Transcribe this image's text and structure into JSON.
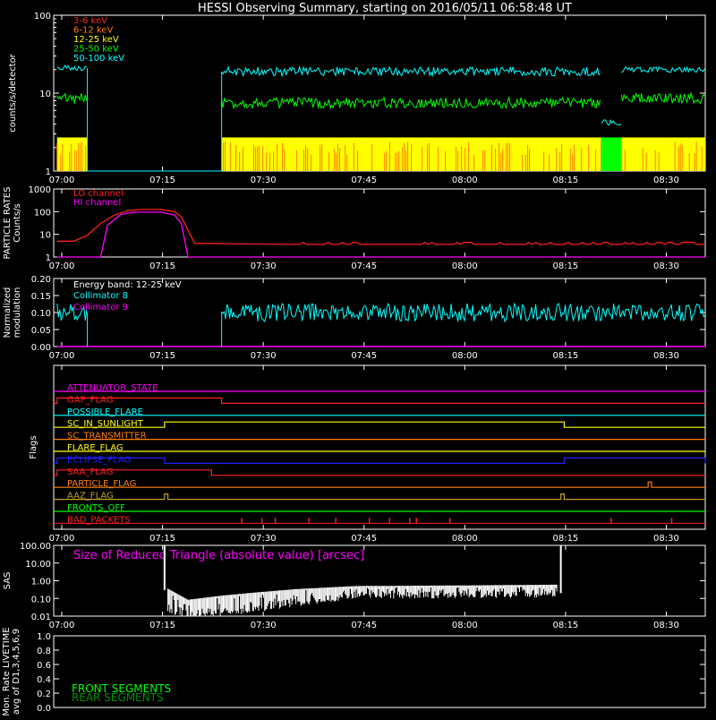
{
  "title": "HESSI Observing Summary, starting on 2016/05/11 06:58:48 UT",
  "time_ticks": [
    "07:00",
    "07:15",
    "07:30",
    "07:45",
    "08:00",
    "08:15",
    "08:30"
  ],
  "colors": {
    "bg": "#000000",
    "fg": "#ffffff",
    "red": "#ff2020",
    "orange": "#ff8000",
    "yellow": "#ffff00",
    "green": "#00ff00",
    "cyan": "#00ffff",
    "magenta": "#ff00ff",
    "blue": "#2020ff",
    "olive": "#c0a020",
    "purple": "#c030c0"
  },
  "chart_data": [
    {
      "type": "line",
      "id": "counts",
      "ylabel": "counts/s/detector",
      "yscale": "log",
      "ylim": [
        1,
        100
      ],
      "yticks": [
        "1",
        "10",
        "100"
      ],
      "x_range_min": [
        0,
        97
      ],
      "series": [
        {
          "name": "3-6 keV",
          "color": "#ff2020"
        },
        {
          "name": "6-12 keV",
          "color": "#ff8000"
        },
        {
          "name": "12-25 keV",
          "color": "#ffff00",
          "segments": [
            {
              "x": [
                0.5,
                5
              ],
              "y": 1.5
            },
            {
              "x": [
                25,
                81.5
              ],
              "y": 1.5
            },
            {
              "x": [
                84.5,
                97
              ],
              "y": 1.5
            }
          ]
        },
        {
          "name": "25-50 keV",
          "color": "#00ff00",
          "segments": [
            {
              "x": [
                0.5,
                5
              ],
              "y": 8.5
            },
            {
              "x": [
                25,
                81.5
              ],
              "y": 7.5
            },
            {
              "x": [
                84.5,
                97
              ],
              "y": 8.5
            },
            {
              "x": [
                81.5,
                84.5
              ],
              "y": 1.3
            }
          ]
        },
        {
          "name": "50-100 keV",
          "color": "#00ffff",
          "segments": [
            {
              "x": [
                0.5,
                5
              ],
              "y": 21
            },
            {
              "x": [
                25,
                81.5
              ],
              "y": 19
            },
            {
              "x": [
                81.5,
                84.5
              ],
              "y": 4.2
            },
            {
              "x": [
                84.5,
                97
              ],
              "y": 20
            }
          ]
        }
      ]
    },
    {
      "type": "line",
      "id": "particle",
      "ylabel": "PARTICLE RATES",
      "ylabel2": "Counts/s",
      "yscale": "log",
      "ylim": [
        1,
        1000
      ],
      "yticks": [
        "1",
        "10",
        "100",
        "1000"
      ],
      "series": [
        {
          "name": "LO channel",
          "color": "#ff2020",
          "points": [
            [
              0.5,
              5
            ],
            [
              3,
              5
            ],
            [
              5,
              9
            ],
            [
              7,
              30
            ],
            [
              9,
              70
            ],
            [
              11,
              110
            ],
            [
              13,
              125
            ],
            [
              16,
              125
            ],
            [
              18,
              100
            ],
            [
              19,
              60
            ],
            [
              20,
              15
            ],
            [
              21,
              4
            ],
            [
              24,
              3.2
            ],
            [
              30,
              3.4
            ],
            [
              35,
              4.2
            ],
            [
              97,
              4
            ]
          ]
        },
        {
          "name": "HI channel",
          "color": "#ff00ff",
          "points": [
            [
              0.5,
              1
            ],
            [
              7,
              1
            ],
            [
              8,
              25
            ],
            [
              10,
              75
            ],
            [
              12,
              95
            ],
            [
              16,
              95
            ],
            [
              18,
              70
            ],
            [
              19,
              30
            ],
            [
              20,
              1
            ],
            [
              97,
              1
            ]
          ]
        }
      ]
    },
    {
      "type": "line",
      "id": "modulation",
      "ylabel": "Normalized",
      "ylabel2": "modulation",
      "ylim": [
        0,
        0.2
      ],
      "yticks": [
        "0.00",
        "0.05",
        "0.10",
        "0.15",
        "0.20"
      ],
      "annotation": "Energy band: 12-25 keV",
      "series": [
        {
          "name": "Collimator 8",
          "color": "#00ffff",
          "segments": [
            {
              "x": [
                0.5,
                5
              ],
              "y": 0.1
            },
            {
              "x": [
                25,
                97
              ],
              "y": 0.1
            }
          ]
        },
        {
          "name": "Collimator 9",
          "color": "#ff00ff",
          "segments": [
            {
              "x": [
                0.5,
                97
              ],
              "y": 0.0
            }
          ]
        }
      ]
    },
    {
      "type": "line",
      "id": "flags",
      "ylabel": "Flags",
      "series": [
        {
          "name": "ATTENUATOR_STATE",
          "color": "#ff00ff",
          "high": []
        },
        {
          "name": "GAP_FLAG",
          "color": "#ff2020",
          "high": [
            [
              0.5,
              25
            ]
          ]
        },
        {
          "name": "POSSIBLE_FLARE",
          "color": "#00ffff",
          "high": []
        },
        {
          "name": "SC_IN_SUNLIGHT",
          "color": "#ffff00",
          "high": [
            [
              16.5,
              76
            ]
          ]
        },
        {
          "name": "SC_TRANSMITTER",
          "color": "#ff8000",
          "high": []
        },
        {
          "name": "FLARE_FLAG",
          "color": "#ffff00",
          "high": []
        },
        {
          "name": "ECLIPSE_FLAG",
          "color": "#2020ff",
          "high": [
            [
              0.5,
              16.5
            ],
            [
              76,
              97
            ]
          ]
        },
        {
          "name": "SAA_FLAG",
          "color": "#ff2020",
          "high": [
            [
              0.5,
              23.5
            ]
          ]
        },
        {
          "name": "PARTICLE_FLAG",
          "color": "#ff8000",
          "high": [
            [
              88.5,
              89
            ]
          ]
        },
        {
          "name": "AAZ_FLAG",
          "color": "#c0a020",
          "high": [
            [
              16.5,
              17
            ],
            [
              75.5,
              76
            ]
          ]
        },
        {
          "name": "FRONTS_OFF",
          "color": "#00ff00",
          "high": []
        },
        {
          "name": "BAD_PACKETS",
          "color": "#ff2020",
          "spikes": [
            28,
            31,
            33,
            38,
            42,
            47,
            50,
            53,
            54,
            59,
            83,
            92
          ]
        }
      ]
    },
    {
      "type": "line",
      "id": "sas",
      "ylabel": "SAS",
      "yscale": "log",
      "ylim": [
        0.01,
        100
      ],
      "yticks": [
        "0.01",
        "0.10",
        "1.00",
        "10.00",
        "100.00"
      ],
      "annotation": "Size of Reduced Triangle (absolute value) [arcsec]",
      "series": [
        {
          "name": "",
          "color": "#ffffff",
          "points": [
            [
              16.5,
              100
            ],
            [
              17,
              0.3
            ],
            [
              20,
              0.07
            ],
            [
              25,
              0.12
            ],
            [
              30,
              0.18
            ],
            [
              36,
              0.28
            ],
            [
              45,
              0.42
            ],
            [
              60,
              0.45
            ],
            [
              75,
              0.5
            ],
            [
              75.5,
              100
            ],
            [
              76,
              0.2
            ]
          ]
        }
      ]
    },
    {
      "type": "line",
      "id": "livetime",
      "ylabel": "Mon. Rate LIVETIME",
      "ylabel2": "avg of D1,3,4,5,6,9",
      "ylim": [
        0,
        1
      ],
      "yticks": [
        "0.0",
        "0.2",
        "0.4",
        "0.6",
        "0.8",
        "1.0"
      ],
      "series": [
        {
          "name": "FRONT SEGMENTS",
          "color": "#00ff00"
        },
        {
          "name": "REAR SEGMENTS",
          "color": "#009000"
        }
      ]
    }
  ]
}
